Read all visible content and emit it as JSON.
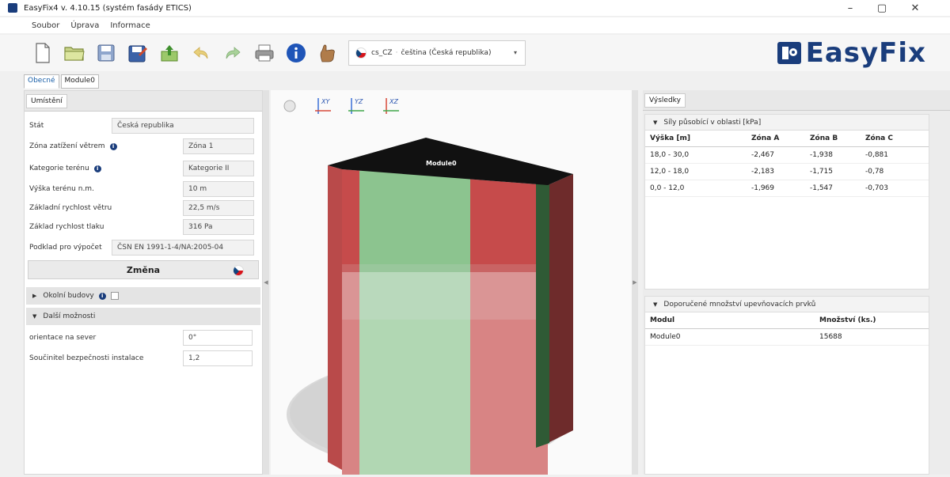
{
  "window": {
    "title": "EasyFix4 v. 4.10.15 (systém fasády ETICS)",
    "minimize": "–",
    "maximize": "▢",
    "close": "✕"
  },
  "menu": [
    "Soubor",
    "Úprava",
    "Informace"
  ],
  "toolbar": {
    "icons": [
      "new-file-icon",
      "open-folder-icon",
      "save-icon",
      "save-as-icon",
      "export-icon",
      "undo-icon",
      "redo-icon",
      "print-icon",
      "info-icon",
      "help-hand-icon"
    ],
    "language_code": "cs_CZ",
    "language_name": "čeština (Česká republika)"
  },
  "logo": {
    "text": "EasyFix"
  },
  "tabs": [
    "Obecné",
    "Module0"
  ],
  "left": {
    "subtab": "Umístění",
    "fields": [
      {
        "label": "Stát",
        "value": "Česká republika"
      },
      {
        "label": "Zóna zatížení větrem",
        "value": "Zóna 1"
      },
      {
        "label": "Kategorie terénu",
        "value": "Kategorie II"
      },
      {
        "label": "Výška terénu n.m.",
        "value": "10 m"
      },
      {
        "label": "Základní rychlost větru",
        "value": "22,5 m/s"
      },
      {
        "label": "Základ rychlost tlaku",
        "value": "316 Pa"
      },
      {
        "label": "Podklad pro výpočet",
        "value": "ČSN EN 1991-1-4/NA:2005-04"
      }
    ],
    "change_button": "Změna",
    "surrounding": "Okolní budovy",
    "more_options": "Další možnosti",
    "options": [
      {
        "label": "orientace na sever",
        "value": "0°"
      },
      {
        "label": "Součinitel bezpečnosti instalace",
        "value": "1,2"
      }
    ]
  },
  "viewport": {
    "axes": [
      "XY",
      "YZ",
      "XZ"
    ],
    "model_label": "Module0"
  },
  "results": {
    "tab": "Výsledky",
    "forces_title": "Síly působící v oblasti [kPa]",
    "forces_columns": [
      "Výška [m]",
      "Zóna A",
      "Zóna B",
      "Zóna C"
    ],
    "forces_rows": [
      [
        "18,0 - 30,0",
        "-2,467",
        "-1,938",
        "-0,881"
      ],
      [
        "12,0 - 18,0",
        "-2,183",
        "-1,715",
        "-0,78"
      ],
      [
        "0,0 - 12,0",
        "-1,969",
        "-1,547",
        "-0,703"
      ]
    ],
    "fasteners_title": "Doporučené množství upevňovacích prvků",
    "fasteners_columns": [
      "Modul",
      "Množství (ks.)"
    ],
    "fasteners_rows": [
      [
        "Module0",
        "15688"
      ]
    ]
  }
}
